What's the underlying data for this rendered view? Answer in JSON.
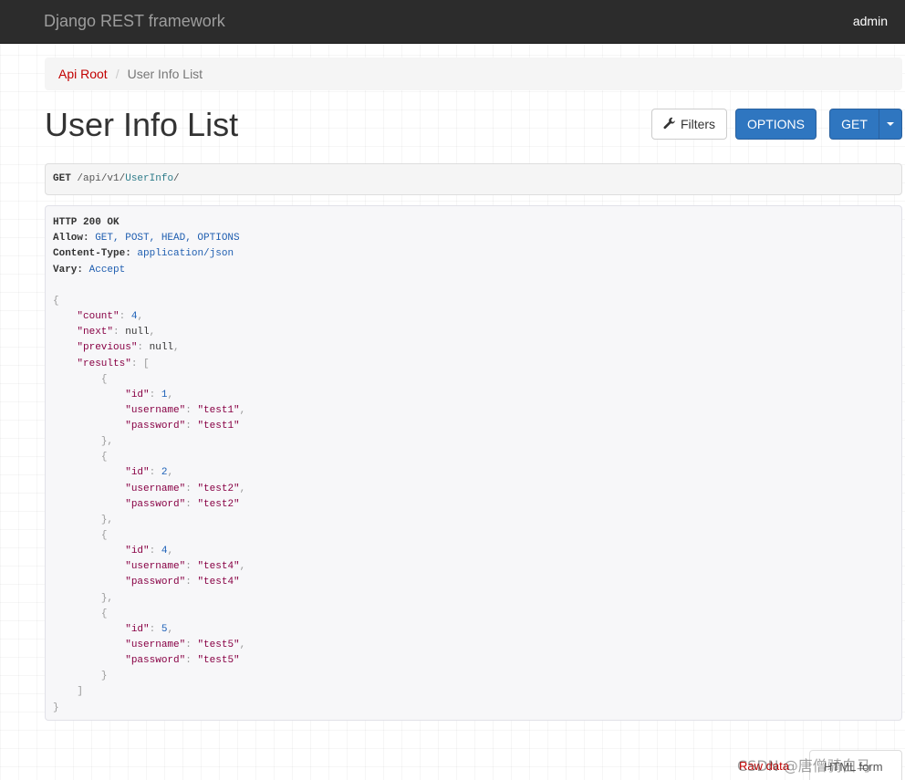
{
  "navbar": {
    "brand": "Django REST framework",
    "user": "admin"
  },
  "breadcrumb": {
    "root": "Api Root",
    "separator": "/",
    "current": "User Info List"
  },
  "page": {
    "title": "User Info List"
  },
  "toolbar": {
    "filters_label": "Filters",
    "options_label": "OPTIONS",
    "get_label": "GET"
  },
  "request": {
    "method": "GET",
    "path_prefix": " /api/v1/",
    "path_link": "UserInfo",
    "path_suffix": "/"
  },
  "response": {
    "status": "HTTP 200 OK",
    "headers": [
      {
        "key": "Allow:",
        "value": " GET, POST, HEAD, OPTIONS"
      },
      {
        "key": "Content-Type:",
        "value": " application/json"
      },
      {
        "key": "Vary:",
        "value": " Accept"
      }
    ],
    "count": 4,
    "next": "null",
    "previous": "null",
    "results": [
      {
        "id": 1,
        "username": "\"test1\"",
        "password": "\"test1\""
      },
      {
        "id": 2,
        "username": "\"test2\"",
        "password": "\"test2\""
      },
      {
        "id": 4,
        "username": "\"test4\"",
        "password": "\"test4\""
      },
      {
        "id": 5,
        "username": "\"test5\"",
        "password": "\"test5\""
      }
    ]
  },
  "format_tabs": {
    "raw": "Raw data",
    "html": "HTML form"
  },
  "watermark": "CSDN @唐僧骑白马",
  "colors": {
    "navbar_bg": "#2c2c2c",
    "primary_button": "#2f76c0",
    "link": "#c20000",
    "json_key": "#880044",
    "json_number": "#1c60b8"
  }
}
